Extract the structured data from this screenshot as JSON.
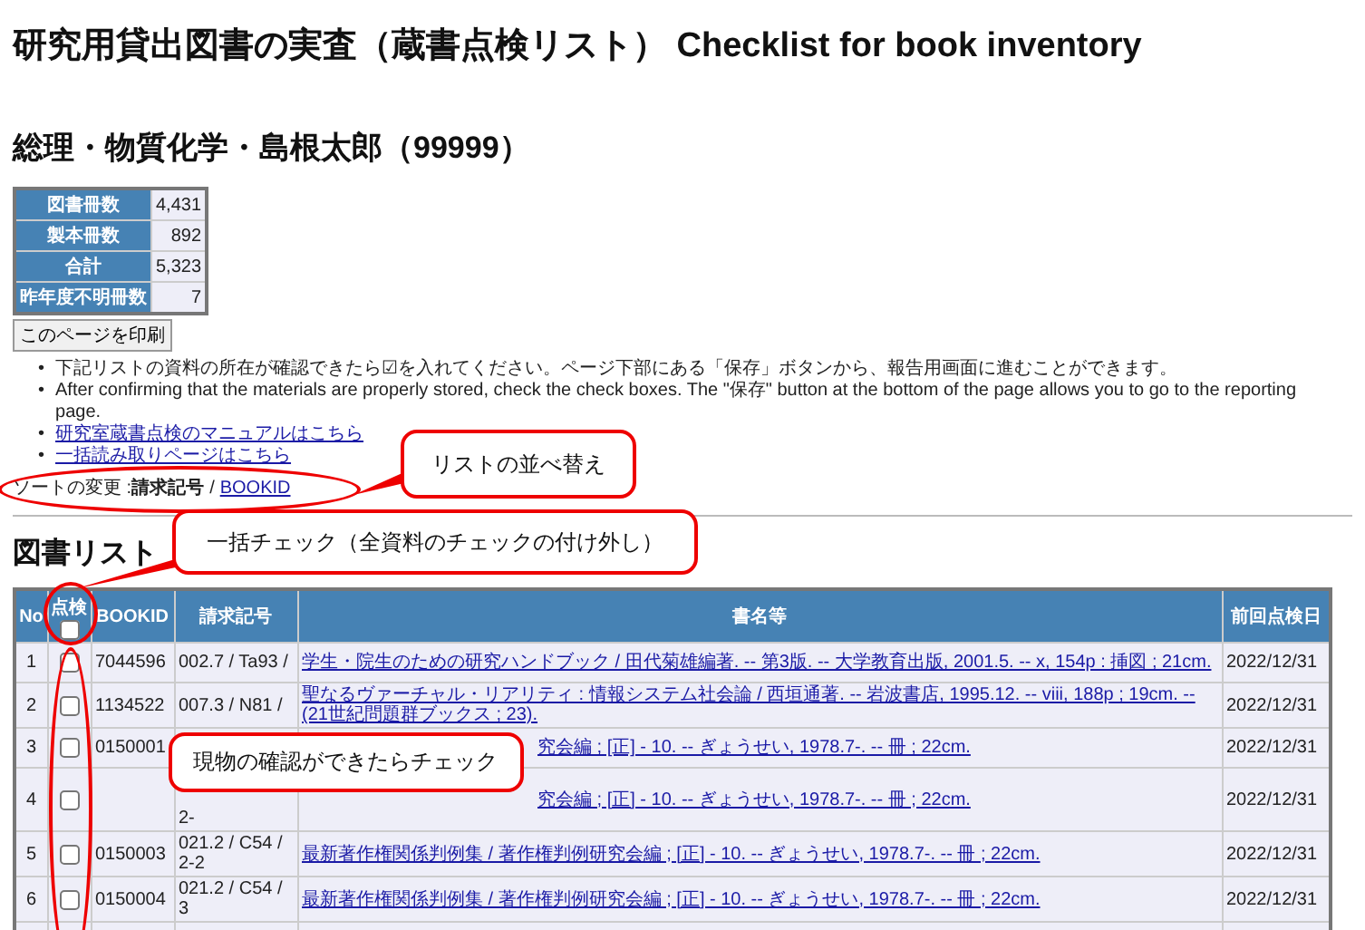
{
  "title": "研究用貸出図書の実査（蔵書点検リスト） Checklist for book inventory",
  "owner": "総理・物質化学・島根太郎（99999）",
  "stats": [
    {
      "label": "図書冊数",
      "value": "4,431"
    },
    {
      "label": "製本冊数",
      "value": "892"
    },
    {
      "label": "合計",
      "value": "5,323"
    },
    {
      "label": "昨年度不明冊数",
      "value": "7"
    }
  ],
  "print_button": "このページを印刷",
  "notes": [
    {
      "kind": "text",
      "marker": "•",
      "text": "下記リストの資料の所在が確認できたら☑を入れてください。ページ下部にある「保存」ボタンから、報告用画面に進むことができます。"
    },
    {
      "kind": "text",
      "marker": "•",
      "text": "After confirming that the materials are properly stored, check the check boxes. The \"保存\" button at the bottom of the page allows you to go to the reporting page."
    },
    {
      "kind": "link",
      "marker": "•",
      "text": "研究室蔵書点検のマニュアルはこちら"
    },
    {
      "kind": "link",
      "marker": "•",
      "text": "一括読み取りページはこちら"
    }
  ],
  "sort": {
    "label": "ソートの変更 :",
    "separator": "/",
    "options": [
      {
        "label": "請求記号",
        "selected": true
      },
      {
        "label": "BOOKID",
        "selected": false
      }
    ]
  },
  "list_title": "図書リスト",
  "table": {
    "columns": [
      "No",
      "点検",
      "BOOKID",
      "請求記号",
      "書名等",
      "前回点検日"
    ],
    "check_all": false,
    "rows": [
      {
        "no": "1",
        "checked": false,
        "bookid": "7044596",
        "call_number": "002.7 / Ta93 /",
        "title": "学生・院生のための研究ハンドブック / 田代菊雄編著. -- 第3版. -- 大学教育出版, 2001.5. -- x, 154p : 挿図 ; 21cm.",
        "last_checked": "2022/12/31"
      },
      {
        "no": "2",
        "checked": false,
        "bookid": "1134522",
        "call_number": "007.3 / N81 /",
        "title": "聖なるヴァーチャル・リアリティ : 情報システム社会論 / 西垣通著. -- 岩波書店, 1995.12. -- viii, 188p ; 19cm. -- (21世紀問題群ブックス ; 23).",
        "last_checked": "2022/12/31"
      },
      {
        "no": "3",
        "checked": false,
        "bookid": "0150001",
        "call_number": "",
        "title": "究会編 ; [正] - 10. -- ぎょうせい, 1978.7-. -- 冊 ; 22cm.",
        "last_checked": "2022/12/31"
      },
      {
        "no": "4",
        "checked": false,
        "bookid": "",
        "call_number": "2-",
        "title": "究会編 ; [正] - 10. -- ぎょうせい, 1978.7-. -- 冊 ; 22cm.",
        "last_checked": "2022/12/31"
      },
      {
        "no": "5",
        "checked": false,
        "bookid": "0150003",
        "call_number": "021.2 / C54 / 2-2",
        "title": "最新著作権関係判例集 / 著作権判例研究会編 ; [正] - 10. -- ぎょうせい, 1978.7-. -- 冊 ; 22cm.",
        "last_checked": "2022/12/31"
      },
      {
        "no": "6",
        "checked": false,
        "bookid": "0150004",
        "call_number": "021.2 / C54 / 3",
        "title": "最新著作権関係判例集 / 著作権判例研究会編 ; [正] - 10. -- ぎょうせい, 1978.7-. -- 冊 ; 22cm.",
        "last_checked": "2022/12/31"
      }
    ]
  },
  "callouts": [
    "リストの並べ替え",
    "一括チェック（全資料のチェックの付け外し）",
    "現物の確認ができたらチェック"
  ]
}
